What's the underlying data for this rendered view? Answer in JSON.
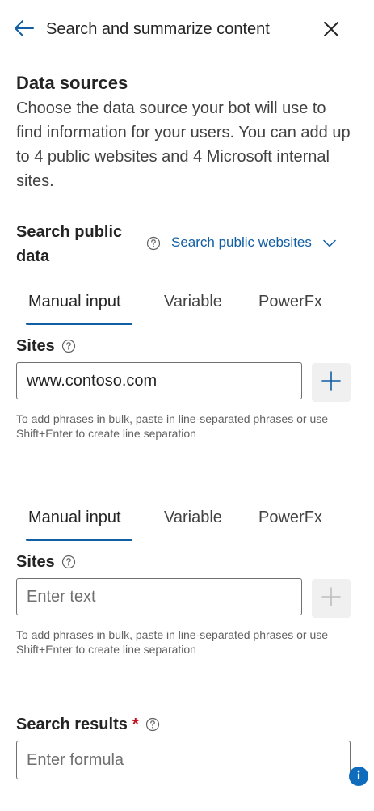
{
  "header": {
    "title": "Search and summarize content",
    "back_icon": "arrow-left-icon",
    "close_icon": "close-icon"
  },
  "data_sources": {
    "title": "Data sources",
    "description": "Choose the data source your bot will use to find information for your users. You can add up to 4 public websites and 4 Microsoft internal sites."
  },
  "search_public_data": {
    "label": "Search public data",
    "dropdown_value": "Search public websites"
  },
  "panel_1": {
    "tabs": [
      "Manual input",
      "Variable",
      "PowerFx"
    ],
    "active_tab": "Manual input",
    "field_label": "Sites",
    "input_value": "www.contoso.com",
    "input_placeholder": "Enter text",
    "hint": "To add phrases in bulk, paste in line-separated phrases or use Shift+Enter to create line separation"
  },
  "panel_2": {
    "tabs": [
      "Manual input",
      "Variable",
      "PowerFx"
    ],
    "active_tab": "Manual input",
    "field_label": "Sites",
    "input_value": "",
    "input_placeholder": "Enter text",
    "hint": "To add phrases in bulk, paste in line-separated phrases or use Shift+Enter to create line separation"
  },
  "search_results": {
    "label": "Search results",
    "required_marker": "*",
    "placeholder": "Enter formula"
  },
  "colors": {
    "accent": "#115ea3",
    "required": "#c50f1f",
    "info_badge": "#0f6cbd"
  }
}
